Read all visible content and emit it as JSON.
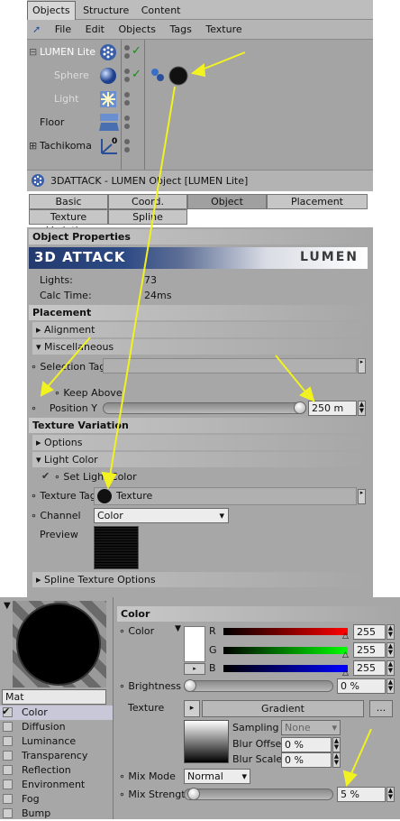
{
  "objects_manager": {
    "tabs": [
      "Objects",
      "Structure",
      "Content"
    ],
    "menu": [
      "File",
      "Edit",
      "Objects",
      "Tags",
      "Texture"
    ],
    "items": [
      {
        "name": "LUMEN Lite"
      },
      {
        "name": "Sphere"
      },
      {
        "name": "Light"
      },
      {
        "name": "Floor"
      },
      {
        "name": "Tachikoma"
      }
    ]
  },
  "attributes": {
    "title": "3DATTACK - LUMEN Object [LUMEN Lite]",
    "tabs_row1": [
      "Basic",
      "Coord.",
      "Object",
      "Placement"
    ],
    "tabs_row2": [
      "Texture Variation",
      "Spline"
    ],
    "object_properties": "Object Properties",
    "banner_left": "3D ATTACK",
    "banner_right": "LUMEN",
    "lights_label": "Lights:",
    "lights_value": "73",
    "calc_label": "Calc Time:",
    "calc_value": "24ms",
    "placement": "Placement",
    "alignment": "Alignment",
    "miscellaneous": "Miscellaneous",
    "selection_tag": "Selection Tag",
    "keep_above": "Keep Above",
    "position_y_label": "Position Y",
    "position_y_value": "250 m",
    "texture_variation": "Texture Variation",
    "options": "Options",
    "light_color": "Light Color",
    "set_light_color": "Set Light Color",
    "texture_tag_label": "Texture Tag",
    "texture_tag_value": "Texture",
    "channel_label": "Channel",
    "channel_value": "Color",
    "preview_label": "Preview",
    "spline_texture_options": "Spline Texture Options"
  },
  "material": {
    "name": "Mat",
    "channels": [
      "Color",
      "Diffusion",
      "Luminance",
      "Transparency",
      "Reflection",
      "Environment",
      "Fog",
      "Bump"
    ],
    "section": "Color",
    "color_label": "Color",
    "r_label": "R",
    "r_value": "255",
    "g_label": "G",
    "g_value": "255",
    "b_label": "B",
    "b_value": "255",
    "brightness_label": "Brightness",
    "brightness_value": "0 %",
    "texture_label": "Texture",
    "texture_value": "Gradient",
    "ellipsis": "...",
    "sampling_label": "Sampling",
    "sampling_value": "None",
    "blur_offset_label": "Blur Offset",
    "blur_offset_value": "0 %",
    "blur_scale_label": "Blur Scale",
    "blur_scale_value": "0 %",
    "mix_mode_label": "Mix Mode",
    "mix_mode_value": "Normal",
    "mix_strength_label": "Mix Strength",
    "mix_strength_value": "5 %"
  },
  "colors": {
    "annotation_arrow": "#f2f221",
    "check": "#1a8a1a",
    "banner": "#2a3a66"
  }
}
